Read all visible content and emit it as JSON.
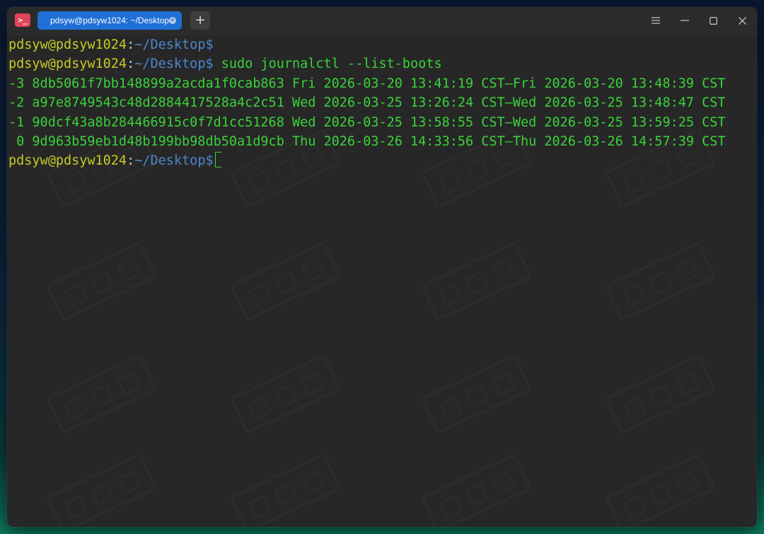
{
  "tab": {
    "title": "pdsyw@pdsyw1024: ~/Desktop"
  },
  "new_tab_label": "+",
  "prompt": {
    "user": "pdsyw@pdsyw1024",
    "colon": ":",
    "path": "~/Desktop$"
  },
  "command": " sudo journalctl --list-boots",
  "output_lines": [
    "-3 8db5061f7bb148899a2acda1f0cab863 Fri 2026-03-20 13:41:19 CST—Fri 2026-03-20 13:48:39 CST",
    "-2 a97e8749543c48d2884417528a4c2c51 Wed 2026-03-25 13:26:24 CST—Wed 2026-03-25 13:48:47 CST",
    "-1 90dcf43a8b284466915c0f7d1cc51268 Wed 2026-03-25 13:58:55 CST—Wed 2026-03-25 13:59:25 CST",
    " 0 9d963b59eb1d48b199bb98db50a1d9cb Thu 2026-03-26 14:33:56 CST—Thu 2026-03-26 14:57:39 CST"
  ],
  "icons": {
    "app": "terminal-icon",
    "menu": "menu-icon",
    "minimize": "minimize-icon",
    "maximize": "maximize-icon",
    "close": "close-icon",
    "tab_close": "tab-close-icon"
  },
  "colors": {
    "user": "#c4cc26",
    "path": "#4d86d0",
    "output": "#3ad23a",
    "background": "#272727",
    "tab_active": "#1f6fd6"
  }
}
